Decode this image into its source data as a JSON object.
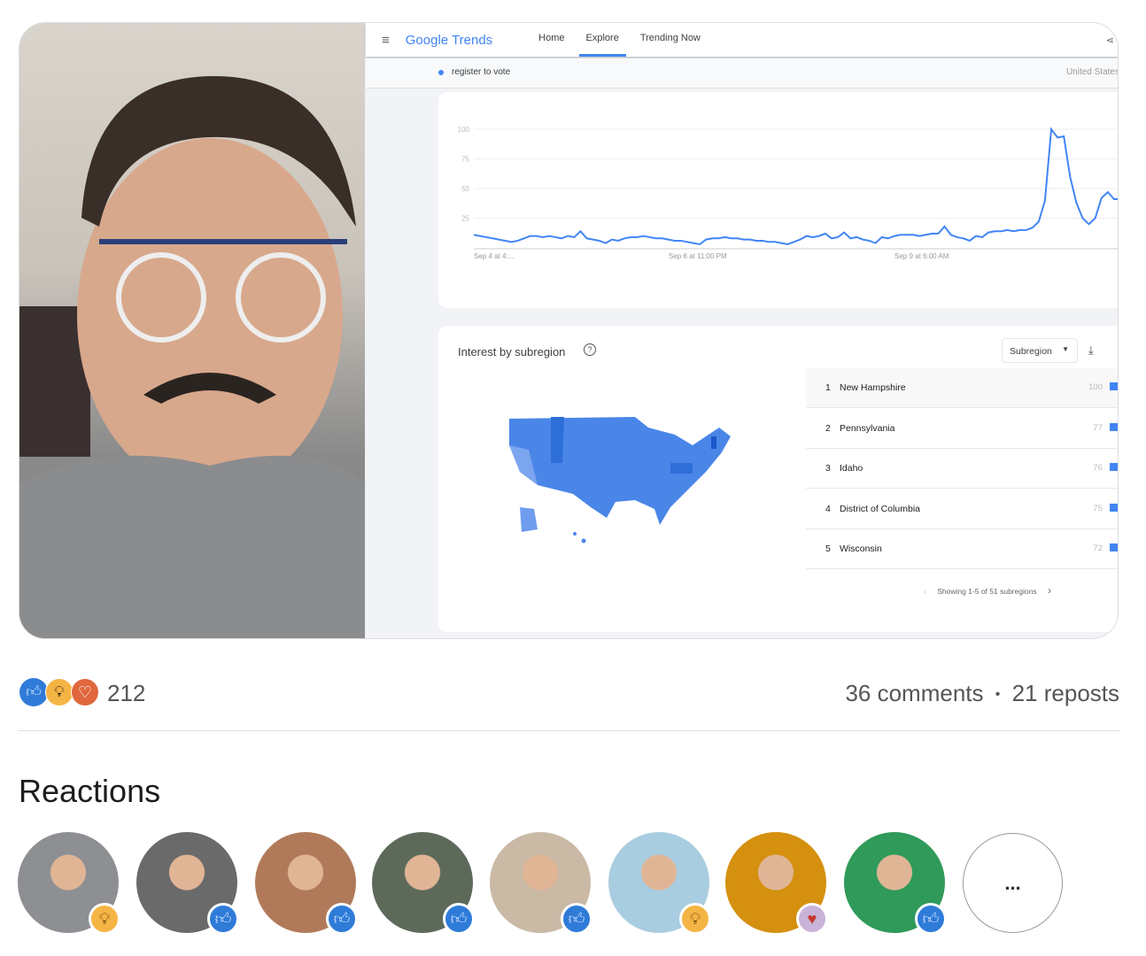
{
  "video": {
    "trends": {
      "brand": "Google Trends",
      "nav": [
        "Home",
        "Explore",
        "Trending Now"
      ],
      "active_nav": "Explore",
      "search_term": "register to vote",
      "region": "United States",
      "subregion_title": "Interest by subregion",
      "subregion_dropdown": "Subregion",
      "subregions": [
        {
          "rank": "1",
          "name": "New Hampshire",
          "value": "100"
        },
        {
          "rank": "2",
          "name": "Pennsylvania",
          "value": "77"
        },
        {
          "rank": "3",
          "name": "Idaho",
          "value": "76"
        },
        {
          "rank": "4",
          "name": "District of Columbia",
          "value": "75"
        },
        {
          "rank": "5",
          "name": "Wisconsin",
          "value": "72"
        }
      ],
      "pagination": "Showing 1-5 of 51 subregions",
      "accent": "#4285f4"
    }
  },
  "chart_data": {
    "type": "line",
    "y_ticks": [
      "100",
      "75",
      "50",
      "25"
    ],
    "ylim": [
      0,
      100
    ],
    "x_ticks": [
      "Sep 4 at 4:...",
      "Sep 6 at 11:00 PM",
      "Sep 9 at 6:00 AM"
    ],
    "grid": true,
    "color": "#4285f4",
    "values": [
      11,
      10,
      9,
      8,
      7,
      6,
      5,
      6,
      8,
      10,
      10,
      9,
      10,
      9,
      8,
      10,
      9,
      14,
      8,
      7,
      6,
      4,
      7,
      6,
      8,
      9,
      9,
      10,
      9,
      8,
      8,
      7,
      6,
      6,
      5,
      4,
      3,
      7,
      8,
      8,
      9,
      8,
      8,
      7,
      7,
      6,
      6,
      5,
      5,
      4,
      3,
      5,
      7,
      10,
      9,
      10,
      12,
      8,
      9,
      13,
      8,
      9,
      7,
      6,
      4,
      9,
      8,
      10,
      11,
      11,
      11,
      10,
      11,
      12,
      12,
      18,
      11,
      9,
      8,
      6,
      10,
      9,
      13,
      14,
      14,
      15,
      14,
      15,
      15,
      17,
      22,
      40,
      100,
      93,
      94,
      60,
      38,
      25,
      20,
      25,
      42,
      47,
      41,
      41
    ]
  },
  "post": {
    "reaction_count": "212",
    "comments": "36 comments",
    "separator": "•",
    "reposts": "21 reposts",
    "reactions_title": "Reactions",
    "more_label": "..."
  },
  "reactors": [
    {
      "badge": "insightful",
      "color": "#8d8f92"
    },
    {
      "badge": "like",
      "color": "#6a6a6a"
    },
    {
      "badge": "like",
      "color": "#b07a5a"
    },
    {
      "badge": "like",
      "color": "#5d6a5a"
    },
    {
      "badge": "like",
      "color": "#c9b9a5"
    },
    {
      "badge": "insightful",
      "color": "#a9cde0"
    },
    {
      "badge": "support",
      "color": "#d4900e"
    },
    {
      "badge": "like",
      "color": "#2f9a5a"
    }
  ]
}
